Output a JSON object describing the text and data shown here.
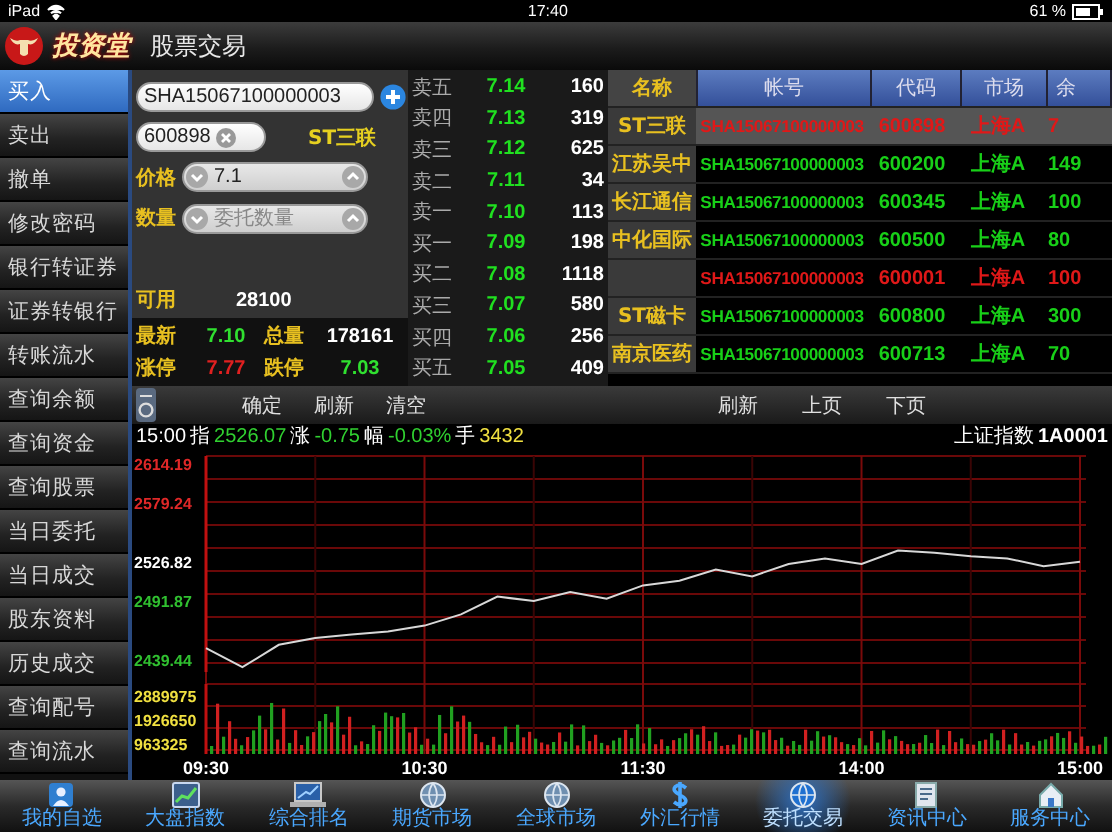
{
  "status_bar": {
    "device": "iPad",
    "time": "17:40",
    "battery": "61 %"
  },
  "header": {
    "brand": "投资堂",
    "title": "股票交易"
  },
  "sidebar": {
    "items": [
      {
        "label": "买入",
        "selected": true
      },
      {
        "label": "卖出",
        "selected": false
      },
      {
        "label": "撤单",
        "selected": false
      },
      {
        "label": "修改密码",
        "selected": false
      },
      {
        "label": "银行转证券",
        "selected": false
      },
      {
        "label": "证券转银行",
        "selected": false
      },
      {
        "label": "转账流水",
        "selected": false
      },
      {
        "label": "查询余额",
        "selected": false
      },
      {
        "label": "查询资金",
        "selected": false
      },
      {
        "label": "查询股票",
        "selected": false
      },
      {
        "label": "当日委托",
        "selected": false
      },
      {
        "label": "当日成交",
        "selected": false
      },
      {
        "label": "股东资料",
        "selected": false
      },
      {
        "label": "历史成交",
        "selected": false
      },
      {
        "label": "查询配号",
        "selected": false
      },
      {
        "label": "查询流水",
        "selected": false
      }
    ]
  },
  "order_form": {
    "account": "SHA15067100000003",
    "code": "600898",
    "stock_name": "ST三联",
    "price_label": "价格",
    "price": "7.1",
    "quantity_label": "数量",
    "quantity_placeholder": "委托数量",
    "available_label": "可用",
    "available": "28100",
    "stats": [
      {
        "label": "最新",
        "value": "7.10",
        "color": "#30e030"
      },
      {
        "label": "总量",
        "value": "178161",
        "color": "#ffffff"
      },
      {
        "label": "涨停",
        "value": "7.77",
        "color": "#e02020"
      },
      {
        "label": "跌停",
        "value": "7.03",
        "color": "#30e030"
      }
    ]
  },
  "quotes": [
    {
      "label": "卖五",
      "price": "7.14",
      "volume": "160"
    },
    {
      "label": "卖四",
      "price": "7.13",
      "volume": "319"
    },
    {
      "label": "卖三",
      "price": "7.12",
      "volume": "625"
    },
    {
      "label": "卖二",
      "price": "7.11",
      "volume": "34"
    },
    {
      "label": "卖一",
      "price": "7.10",
      "volume": "113"
    },
    {
      "label": "买一",
      "price": "7.09",
      "volume": "198"
    },
    {
      "label": "买二",
      "price": "7.08",
      "volume": "1118"
    },
    {
      "label": "买三",
      "price": "7.07",
      "volume": "580"
    },
    {
      "label": "买四",
      "price": "7.06",
      "volume": "256"
    },
    {
      "label": "买五",
      "price": "7.05",
      "volume": "409"
    }
  ],
  "holdings": {
    "columns": [
      "名称",
      "帐号",
      "代码",
      "市场",
      "余"
    ],
    "rows": [
      {
        "name": "ST三联",
        "account": "SHA15067100000003",
        "code": "600898",
        "market": "上海A",
        "balance": "7",
        "highlight": true,
        "selected": true
      },
      {
        "name": "江苏吴中",
        "account": "SHA15067100000003",
        "code": "600200",
        "market": "上海A",
        "balance": "149",
        "highlight": false,
        "selected": false
      },
      {
        "name": "长江通信",
        "account": "SHA15067100000003",
        "code": "600345",
        "market": "上海A",
        "balance": "100",
        "highlight": false,
        "selected": false
      },
      {
        "name": "中化国际",
        "account": "SHA15067100000003",
        "code": "600500",
        "market": "上海A",
        "balance": "80",
        "highlight": false,
        "selected": false
      },
      {
        "account": "SHA15067100000003",
        "code": "600001",
        "market": "上海A",
        "balance": "100",
        "highlight": true,
        "selected": false
      },
      {
        "name": "ST磁卡",
        "account": "SHA15067100000003",
        "code": "600800",
        "market": "上海A",
        "balance": "300",
        "highlight": false,
        "selected": false
      },
      {
        "name": "南京医药",
        "account": "SHA15067100000003",
        "code": "600713",
        "market": "上海A",
        "balance": "70",
        "highlight": false,
        "selected": false
      }
    ]
  },
  "toolbar": {
    "left_buttons": [
      "确定",
      "刷新",
      "清空"
    ],
    "right_buttons": [
      "刷新",
      "上页",
      "下页"
    ]
  },
  "index_info": {
    "time": "15:00",
    "index_label": "指",
    "index_value": "2526.07",
    "change_label": "涨",
    "change": "-0.75",
    "pct_label": "幅",
    "pct": "-0.03%",
    "hands_label": "手",
    "hands": "3432",
    "index_name": "上证指数",
    "index_code": "1A0001"
  },
  "chart": {
    "chart_data": {
      "type": "line",
      "grid": true,
      "ylim": [
        2355.6,
        2621.3
      ],
      "categories": [
        "09:30",
        null,
        null,
        null,
        null,
        null,
        "10:30",
        null,
        null,
        null,
        null,
        null,
        "11:30",
        null,
        null,
        null,
        null,
        null,
        "14:00",
        null,
        null,
        null,
        null,
        null,
        "15:00"
      ],
      "yticks": [
        2614.19,
        2579.24,
        2526.82,
        2491.87,
        2439.44
      ],
      "series": [
        {
          "color": "#d8d8d8",
          "values": [
            2450,
            2433,
            2453,
            2459,
            2462,
            2465,
            2470,
            2480,
            2496,
            2492,
            2500,
            2494,
            2506,
            2510,
            2520,
            2514,
            2525,
            2530,
            2525,
            2537,
            2535,
            2532,
            2530,
            2523,
            2527
          ]
        }
      ]
    },
    "volume_labels": [
      "2889975",
      "1926650",
      "963325"
    ]
  },
  "tab_bar": {
    "items": [
      {
        "label": "我的自选",
        "selected": false
      },
      {
        "label": "大盘指数",
        "selected": false
      },
      {
        "label": "综合排名",
        "selected": false
      },
      {
        "label": "期货市场",
        "selected": false
      },
      {
        "label": "全球市场",
        "selected": false
      },
      {
        "label": "外汇行情",
        "selected": false
      },
      {
        "label": "委托交易",
        "selected": true
      },
      {
        "label": "资讯中心",
        "selected": false
      },
      {
        "label": "服务中心",
        "selected": false
      }
    ]
  }
}
